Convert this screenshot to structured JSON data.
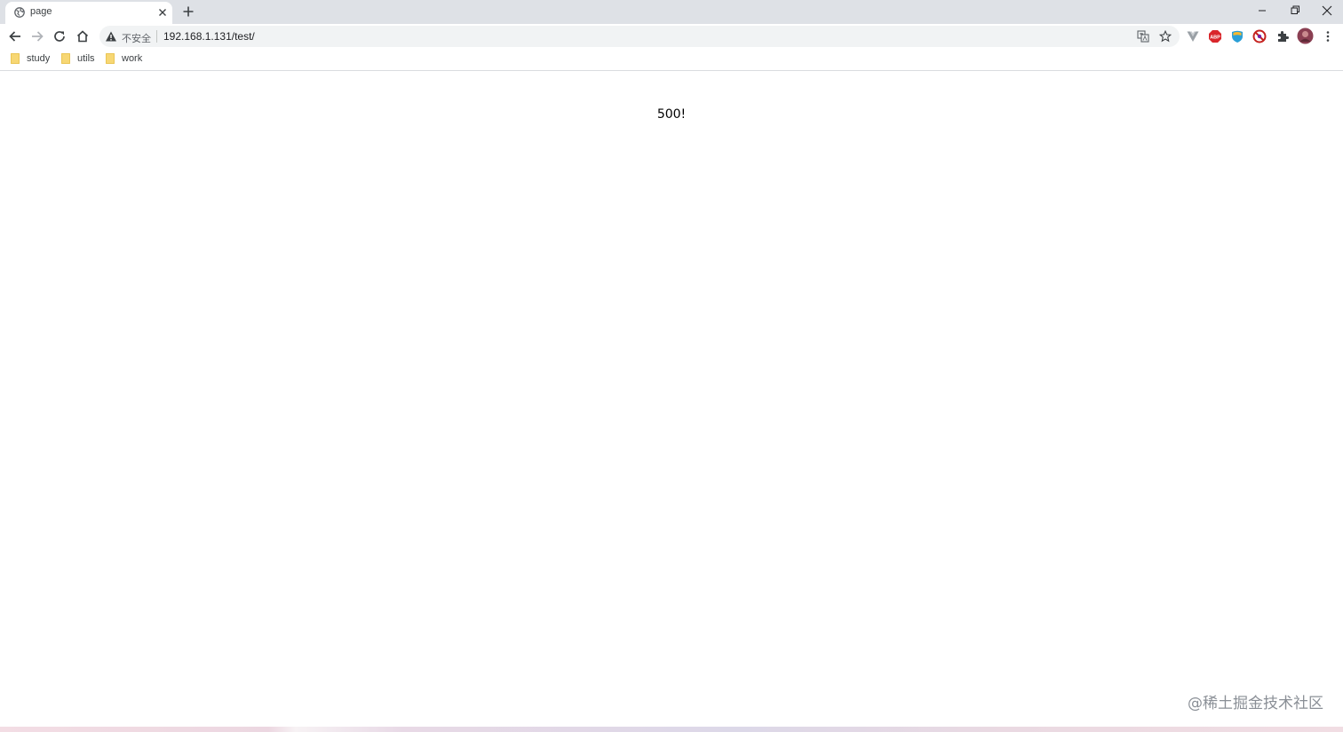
{
  "tab": {
    "title": "page"
  },
  "omnibox": {
    "security_label": "不安全",
    "url": "192.168.1.131/test/"
  },
  "bookmarks": [
    {
      "label": "study"
    },
    {
      "label": "utils"
    },
    {
      "label": "work"
    }
  ],
  "page": {
    "message": "500!"
  },
  "watermark": "@稀土掘金技术社区",
  "colors": {
    "tabstrip": "#dee1e6",
    "omnibox": "#f1f3f4",
    "folder": "#f7d774",
    "abp": "#d9262b",
    "profile": "#8a3f52"
  },
  "icons": [
    "globe-icon",
    "close-icon",
    "plus-icon",
    "minimize-icon",
    "restore-icon",
    "window-close-icon",
    "back-icon",
    "forward-icon",
    "reload-icon",
    "home-icon",
    "warning-icon",
    "translate-icon",
    "star-icon",
    "vue-devtools-icon",
    "adblock-plus-icon",
    "extension-shield-icon",
    "block-icon",
    "puzzle-icon",
    "avatar",
    "kebab-menu-icon",
    "folder-icon"
  ]
}
